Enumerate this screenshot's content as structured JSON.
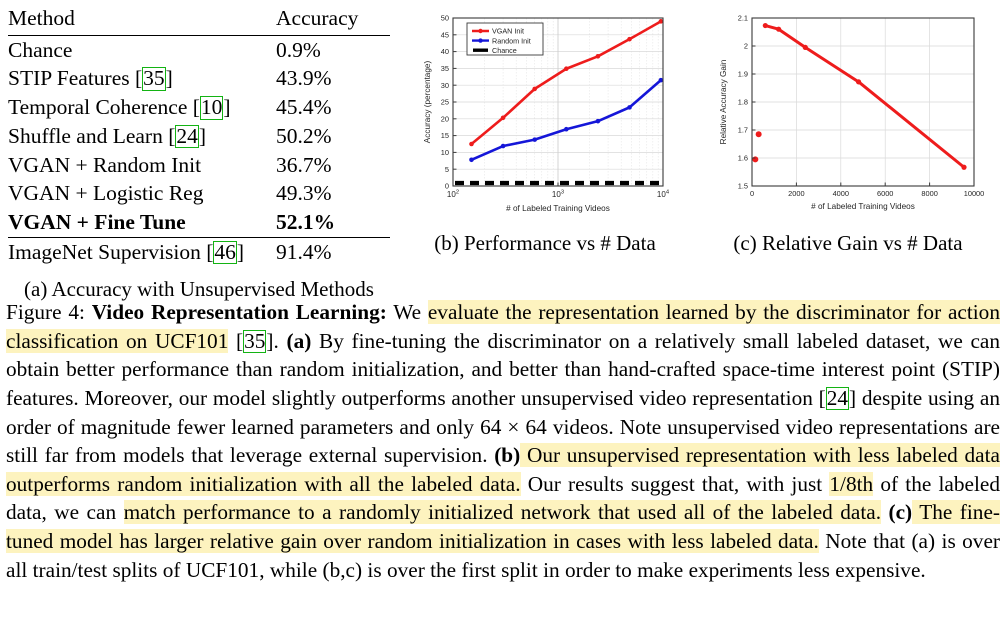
{
  "table": {
    "headers": [
      "Method",
      "Accuracy"
    ],
    "rows": [
      {
        "method": "Chance",
        "cite": "",
        "accuracy": "0.9%",
        "bold": false
      },
      {
        "method": "STIP Features",
        "cite": "35",
        "accuracy": "43.9%",
        "bold": false
      },
      {
        "method": "Temporal Coherence",
        "cite": "10",
        "accuracy": "45.4%",
        "bold": false
      },
      {
        "method": "Shuffle and Learn",
        "cite": "24",
        "accuracy": "50.2%",
        "bold": false
      },
      {
        "method": "VGAN + Random Init",
        "cite": "",
        "accuracy": "36.7%",
        "bold": false
      },
      {
        "method": "VGAN + Logistic Reg",
        "cite": "",
        "accuracy": "49.3%",
        "bold": false
      },
      {
        "method": "VGAN + Fine Tune",
        "cite": "",
        "accuracy": "52.1%",
        "bold": true
      }
    ],
    "footer_row": {
      "method": "ImageNet Supervision",
      "cite": "46",
      "accuracy": "91.4%"
    },
    "subcaption": "(a) Accuracy with Unsupervised Methods"
  },
  "chart_data": [
    {
      "id": "b",
      "type": "line",
      "title": "",
      "subcaption": "(b) Performance vs # Data",
      "xlabel": "# of Labeled Training Videos",
      "ylabel": "Accuracy (percentage)",
      "xscale": "log",
      "xlim": [
        100,
        10000
      ],
      "ylim": [
        0,
        50
      ],
      "yticks": [
        0,
        5,
        10,
        15,
        20,
        25,
        30,
        35,
        40,
        45,
        50
      ],
      "xticks": [
        100,
        1000,
        10000
      ],
      "xticklabels": [
        "10^2",
        "10^3",
        "10^4"
      ],
      "grid": true,
      "legend_position": "top-left",
      "x": [
        150,
        300,
        600,
        1200,
        2400,
        4800,
        9550
      ],
      "series": [
        {
          "name": "VGAN Init",
          "color": "#ee1c1c",
          "style": "solid-marker",
          "values": [
            12.5,
            20.3,
            28.9,
            34.9,
            38.6,
            43.7,
            49.0
          ]
        },
        {
          "name": "Random Init",
          "color": "#1516d8",
          "style": "solid-marker",
          "values": [
            7.8,
            11.9,
            13.8,
            16.9,
            19.3,
            23.4,
            31.5
          ]
        },
        {
          "name": "Chance",
          "color": "#000000",
          "style": "dashed",
          "values": [
            0.9,
            0.9,
            0.9,
            0.9,
            0.9,
            0.9,
            0.9
          ]
        }
      ]
    },
    {
      "id": "c",
      "type": "line",
      "title": "",
      "subcaption": "(c) Relative Gain vs # Data",
      "xlabel": "# of Labeled Training Videos",
      "ylabel": "Relative Accuracy Gain",
      "xscale": "linear",
      "xlim": [
        0,
        10000
      ],
      "ylim": [
        1.5,
        2.1
      ],
      "yticks": [
        1.5,
        1.6,
        1.7,
        1.8,
        1.9,
        2.0,
        2.1
      ],
      "yticklabels": [
        "1.5",
        "1.6",
        "1.7",
        "1.8",
        "1.9",
        "2",
        "2.1"
      ],
      "xticks": [
        0,
        2000,
        4000,
        6000,
        8000,
        10000
      ],
      "xticklabels": [
        "0",
        "2000",
        "4000",
        "6000",
        "8000",
        "10000"
      ],
      "grid": true,
      "legend_position": "none",
      "color": "#ee1c1c",
      "scatter_points": [
        {
          "x": 150,
          "y": 1.595
        },
        {
          "x": 300,
          "y": 1.685
        }
      ],
      "line_points": [
        {
          "x": 600,
          "y": 2.073
        },
        {
          "x": 1200,
          "y": 2.06
        },
        {
          "x": 2400,
          "y": 1.995
        },
        {
          "x": 4800,
          "y": 1.872
        },
        {
          "x": 9550,
          "y": 1.567
        }
      ]
    }
  ],
  "caption": {
    "figure_label": "Figure 4:",
    "figure_title": "Video Representation Learning:",
    "seg1_plain": " We ",
    "seg2_hl": "evaluate the representation learned by the discrimi­nator for action classification on UCF101",
    "seg3_plain_a": " [",
    "cite1": "35",
    "seg3_plain_b": "]. ",
    "bold_a": "(a)",
    "seg4_plain": " By fine-tuning the discriminator on a relatively small labeled dataset, we can obtain better performance than random initialization, and better than hand-crafted space-time interest point (STIP) features. Moreover, our model slightly outperforms another unsupervised video representation [",
    "cite2": "24",
    "seg5_plain": "] despite using an order of magnitude fewer learned parameters and only 64 × 64 videos.  Note unsupervised video representations are still far from models that leverage external supervision. ",
    "bold_b": "(b)",
    "seg6_hl": " Our unsupervised representation with less labeled data outperforms random initialization with all the labeled data.",
    "seg7_plain": " Our results suggest that, with just ",
    "seg8_hl": "1/8th",
    "seg9_plain": " of the labeled data, we can ",
    "seg10_hl": "match performance to a randomly initialized network that used all of the labeled data.",
    "seg11_plain": " ",
    "bold_c": "(c)",
    "seg12_hl": " The fine-tuned model has larger relative gain over random initialization in cases with less labeled data.",
    "seg13_plain": " Note that (a) is over all train/test splits of UCF101, while (b,c) is over the first split in order to make experiments less expensive."
  }
}
